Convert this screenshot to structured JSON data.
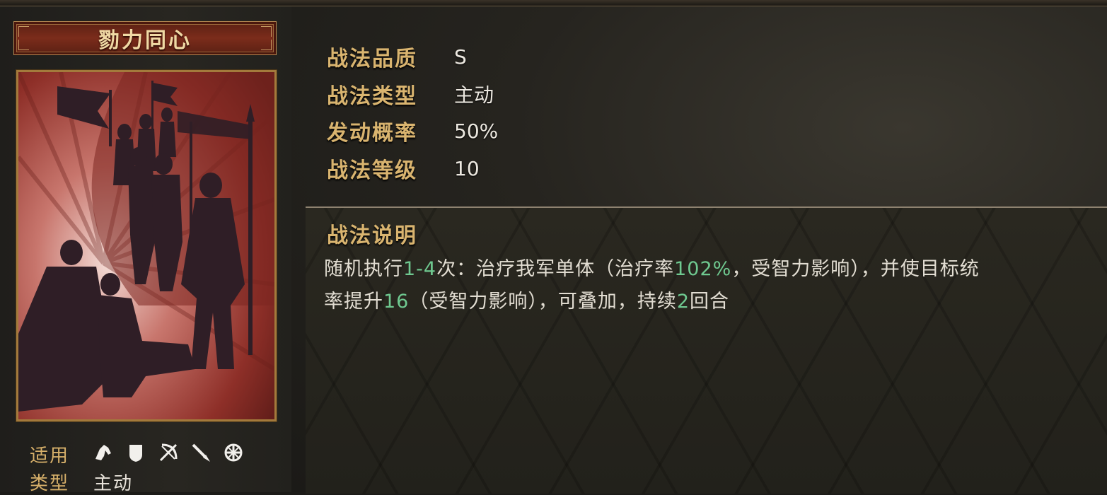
{
  "skill": {
    "name": "勠力同心"
  },
  "attributes": [
    {
      "label": "战法品质",
      "value": "S"
    },
    {
      "label": "战法类型",
      "value": "主动"
    },
    {
      "label": "发动概率",
      "value": "50%"
    },
    {
      "label": "战法等级",
      "value": "10"
    }
  ],
  "description": {
    "title": "战法说明",
    "line1": [
      {
        "text": "随机执行",
        "green": false
      },
      {
        "text": "1-4",
        "green": true
      },
      {
        "text": "次：治疗我军单体（治疗率",
        "green": false
      },
      {
        "text": "102%",
        "green": true
      },
      {
        "text": "，受智力影响），并使目标统",
        "green": false
      }
    ],
    "line2": [
      {
        "text": "率提升",
        "green": false
      },
      {
        "text": "16",
        "green": true
      },
      {
        "text": "（受智力影响），可叠加，持续",
        "green": false
      },
      {
        "text": "2",
        "green": true
      },
      {
        "text": "回合",
        "green": false
      }
    ]
  },
  "applicable": {
    "label": "适用",
    "icons": [
      "cavalry-icon",
      "shield-icon",
      "archer-icon",
      "spear-icon",
      "siege-wheel-icon"
    ]
  },
  "type": {
    "label": "类型",
    "value": "主动"
  },
  "colors": {
    "gold_label": "#d9b46f",
    "highlight_green": "#6fc990",
    "banner_red": "#7b2c1b"
  }
}
